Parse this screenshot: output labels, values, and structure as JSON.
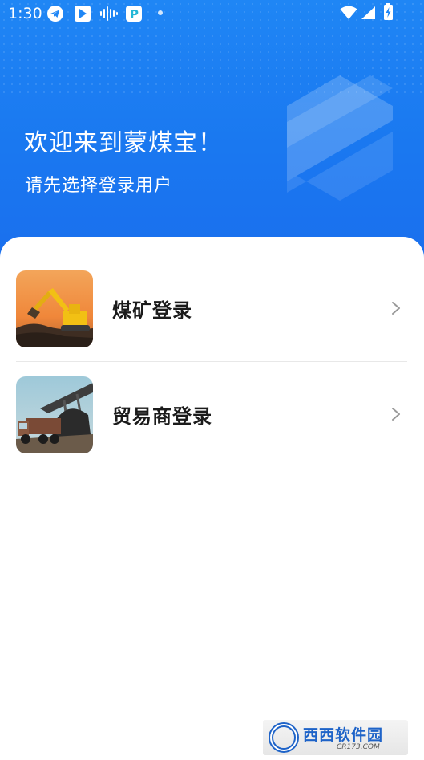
{
  "status_bar": {
    "time": "1:30",
    "icons": [
      "telegram-icon",
      "play-store-icon",
      "audio-wave-icon",
      "parking-app-icon",
      "notification-dot-icon",
      "wifi-icon",
      "cellular-signal-icon",
      "battery-charging-icon"
    ]
  },
  "header": {
    "title": "欢迎来到蒙煤宝！",
    "subtitle": "请先选择登录用户"
  },
  "login_options": [
    {
      "label": "煤矿登录",
      "image": "excavator-photo"
    },
    {
      "label": "贸易商登录",
      "image": "coal-truck-photo"
    }
  ],
  "watermark": {
    "main": "西西软件园",
    "sub": "CR173.COM"
  },
  "colors": {
    "brand_blue": "#1a78f0",
    "text_dark": "#1b1b1b",
    "divider": "#e8e8e8"
  }
}
